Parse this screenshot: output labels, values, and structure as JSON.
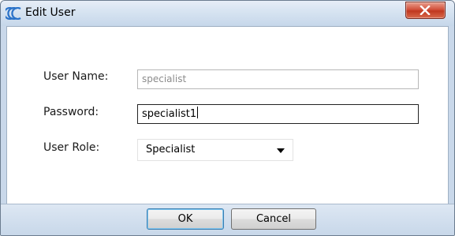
{
  "window": {
    "title": "Edit User",
    "app_icon": "app-logo-icon",
    "close_icon": "close-icon"
  },
  "form": {
    "username": {
      "label": "User Name:",
      "value": "specialist"
    },
    "password": {
      "label": "Password:",
      "value": "specialist1"
    },
    "role": {
      "label": "User Role:",
      "selected": "Specialist",
      "arrow_icon": "dropdown-arrow-icon"
    }
  },
  "buttons": {
    "ok": "OK",
    "cancel": "Cancel"
  },
  "colors": {
    "close_button": "#c9442b",
    "titlebar": "#d6e3f1",
    "footer": "#c9d8ea"
  }
}
